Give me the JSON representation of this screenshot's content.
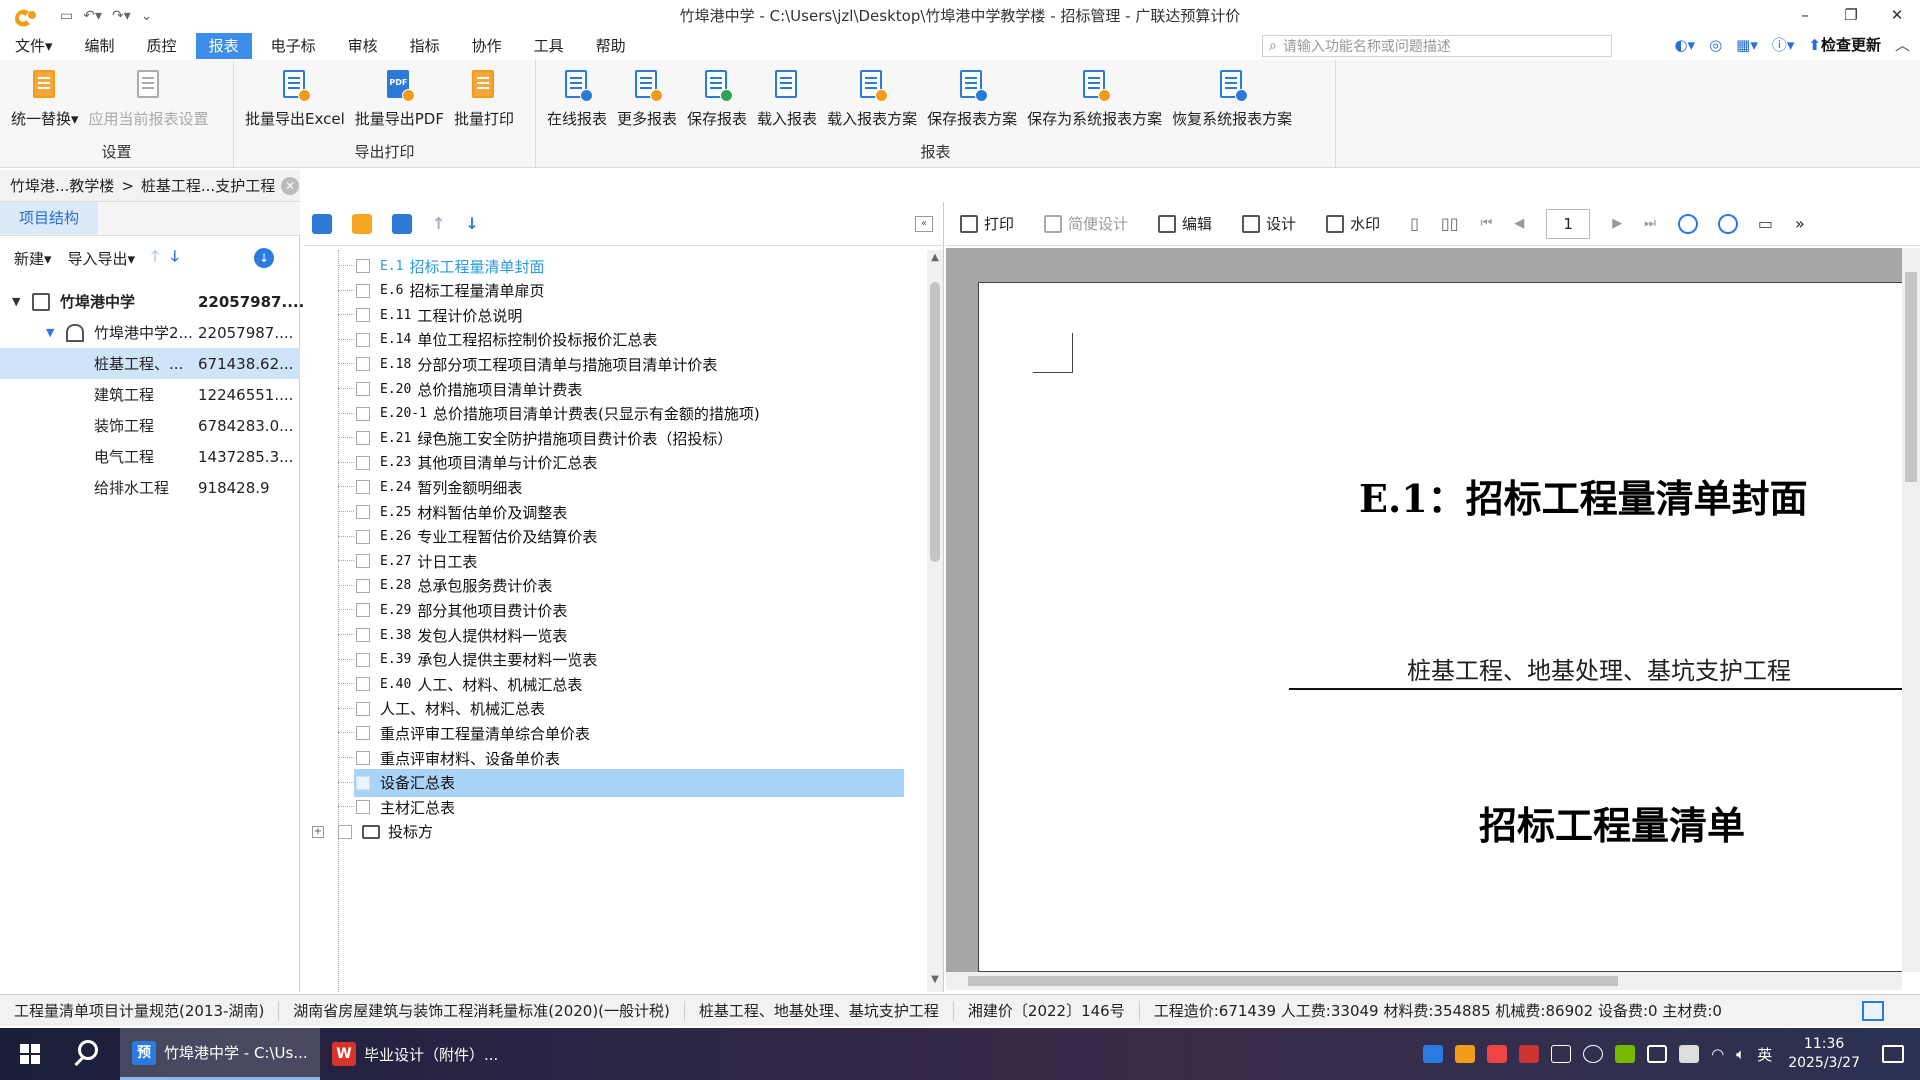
{
  "window": {
    "title": "竹埠港中学 - C:\\Users\\jzl\\Desktop\\竹埠港中学教学楼 - 招标管理 - 广联达预算计价",
    "controls": [
      "–",
      "❐",
      "✕"
    ]
  },
  "menubar": {
    "items": [
      "文件▾",
      "编制",
      "质控",
      "报表",
      "电子标",
      "审核",
      "指标",
      "协作",
      "工具",
      "帮助"
    ],
    "active_index": 3,
    "search_placeholder": "请输入功能名称或问题描述",
    "check_update": "检查更新"
  },
  "ribbon": {
    "groups": [
      {
        "label": "设置",
        "buttons": [
          {
            "label": "统一替换▾",
            "icon": "replace-icon"
          },
          {
            "label": "应用当前报表设置",
            "icon": "apply-settings-icon",
            "disabled": true
          }
        ]
      },
      {
        "label": "导出打印",
        "buttons": [
          {
            "label": "批量导出Excel",
            "icon": "export-excel-icon"
          },
          {
            "label": "批量导出PDF",
            "icon": "export-pdf-icon"
          },
          {
            "label": "批量打印",
            "icon": "batch-print-icon"
          }
        ]
      },
      {
        "label": "报表",
        "buttons": [
          {
            "label": "在线报表",
            "icon": "online-report-icon"
          },
          {
            "label": "更多报表",
            "icon": "more-reports-icon"
          },
          {
            "label": "保存报表",
            "icon": "save-report-icon"
          },
          {
            "label": "载入报表",
            "icon": "load-report-icon"
          },
          {
            "label": "载入报表方案",
            "icon": "load-scheme-icon"
          },
          {
            "label": "保存报表方案",
            "icon": "save-scheme-icon"
          },
          {
            "label": "保存为系统报表方案",
            "icon": "save-system-scheme-icon"
          },
          {
            "label": "恢复系统报表方案",
            "icon": "restore-scheme-icon"
          }
        ]
      }
    ]
  },
  "breadcrumb": {
    "parts": [
      "竹埠港...教学楼",
      "桩基工程...支护工程"
    ],
    "sep": ">"
  },
  "leftpanel": {
    "tab": "项目结构",
    "toolbar": {
      "new": "新建▾",
      "import_export": "导入导出▾"
    },
    "tree": [
      {
        "name": "竹埠港中学",
        "value": "22057987....",
        "level": 0,
        "bold": true,
        "icon": "building-icon"
      },
      {
        "name": "竹埠港中学2...",
        "value": "22057987....",
        "level": 1,
        "icon": "home-icon"
      },
      {
        "name": "桩基工程、...",
        "value": "671438.62...",
        "level": 2,
        "selected": true
      },
      {
        "name": "建筑工程",
        "value": "12246551....",
        "level": 2
      },
      {
        "name": "装饰工程",
        "value": "6784283.0...",
        "level": 2
      },
      {
        "name": "电气工程",
        "value": "1437285.3...",
        "level": 2
      },
      {
        "name": "给排水工程",
        "value": "918428.9",
        "level": 2
      }
    ]
  },
  "reports": {
    "items": [
      {
        "code": "E.1",
        "name": "招标工程量清单封面",
        "first": true
      },
      {
        "code": "E.6",
        "name": "招标工程量清单扉页"
      },
      {
        "code": "E.11",
        "name": "工程计价总说明"
      },
      {
        "code": "E.14",
        "name": "单位工程招标控制价投标报价汇总表"
      },
      {
        "code": "E.18",
        "name": "分部分项工程项目清单与措施项目清单计价表"
      },
      {
        "code": "E.20",
        "name": "总价措施项目清单计费表"
      },
      {
        "code": "E.20-1",
        "name": "总价措施项目清单计费表(只显示有金额的措施项)"
      },
      {
        "code": "E.21",
        "name": "绿色施工安全防护措施项目费计价表（招投标）"
      },
      {
        "code": "E.23",
        "name": "其他项目清单与计价汇总表"
      },
      {
        "code": "E.24",
        "name": "暂列金额明细表"
      },
      {
        "code": "E.25",
        "name": "材料暂估单价及调整表"
      },
      {
        "code": "E.26",
        "name": "专业工程暂估价及结算价表"
      },
      {
        "code": "E.27",
        "name": "计日工表"
      },
      {
        "code": "E.28",
        "name": "总承包服务费计价表"
      },
      {
        "code": "E.29",
        "name": "部分其他项目费计价表"
      },
      {
        "code": "E.38",
        "name": "发包人提供材料一览表"
      },
      {
        "code": "E.39",
        "name": "承包人提供主要材料一览表"
      },
      {
        "code": "E.40",
        "name": "人工、材料、机械汇总表"
      },
      {
        "code": "",
        "name": "人工、材料、机械汇总表"
      },
      {
        "code": "",
        "name": "重点评审工程量清单综合单价表"
      },
      {
        "code": "",
        "name": "重点评审材料、设备单价表"
      },
      {
        "code": "",
        "name": "设备汇总表",
        "selected": true
      },
      {
        "code": "",
        "name": "主材汇总表"
      }
    ],
    "group_node": "投标方"
  },
  "preview": {
    "toolbar": {
      "print": "打印",
      "simple_design": "简便设计",
      "edit": "编辑",
      "design": "设计",
      "watermark": "水印",
      "page": "1"
    },
    "doc": {
      "title": "E.1：招标工程量清单封面",
      "subtitle": "桩基工程、地基处理、基坑支护工程",
      "heading": "招标工程量清单"
    }
  },
  "statusbar": {
    "items": [
      "工程量清单项目计量规范(2013-湖南)",
      "湖南省房屋建筑与装饰工程消耗量标准(2020)(一般计税)",
      "桩基工程、地基处理、基坑支护工程",
      "湘建价〔2022〕146号",
      "工程造价:671439  人工费:33049  材料费:354885  机械费:86902  设备费:0  主材费:0"
    ]
  },
  "taskbar": {
    "apps": [
      {
        "label": "竹埠港中学 - C:\\Us...",
        "icon": "预",
        "active": true,
        "color": "#2a7ae2"
      },
      {
        "label": "毕业设计（附件）...",
        "icon": "W",
        "active": false,
        "color": "#d9342b"
      }
    ],
    "ime": "英",
    "time": "11:36",
    "date": "2025/3/27"
  },
  "colors": {
    "accent": "#3d8eea",
    "selection": "#a9d4f7",
    "tree_selected": "#cfe4f8"
  }
}
